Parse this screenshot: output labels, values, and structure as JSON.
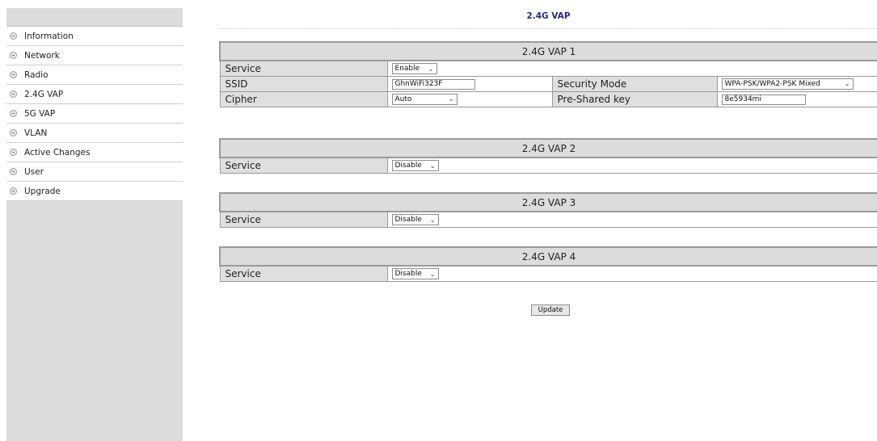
{
  "page": {
    "title": "2.4G VAP"
  },
  "sidebar": {
    "items": [
      {
        "label": "Information"
      },
      {
        "label": "Network"
      },
      {
        "label": "Radio"
      },
      {
        "label": "2.4G VAP"
      },
      {
        "label": "5G VAP"
      },
      {
        "label": "VLAN"
      },
      {
        "label": "Active Changes"
      },
      {
        "label": "User"
      },
      {
        "label": "Upgrade"
      }
    ]
  },
  "vap1": {
    "title": "2.4G VAP 1",
    "service_label": "Service",
    "service_value": "Enable",
    "ssid_label": "SSID",
    "ssid_value": "GhnWiFi323F",
    "security_label": "Security Mode",
    "security_value": "WPA-PSK/WPA2-PSK Mixed",
    "cipher_label": "Cipher",
    "cipher_value": "Auto",
    "psk_label": "Pre-Shared key",
    "psk_value": "8e5934mi"
  },
  "vap2": {
    "title": "2.4G VAP 2",
    "service_label": "Service",
    "service_value": "Disable"
  },
  "vap3": {
    "title": "2.4G VAP 3",
    "service_label": "Service",
    "service_value": "Disable"
  },
  "vap4": {
    "title": "2.4G VAP 4",
    "service_label": "Service",
    "service_value": "Disable"
  },
  "update_label": "Update",
  "icons": {
    "chevron": "chevron-down-icon",
    "nav": "minus-circle-icon"
  }
}
